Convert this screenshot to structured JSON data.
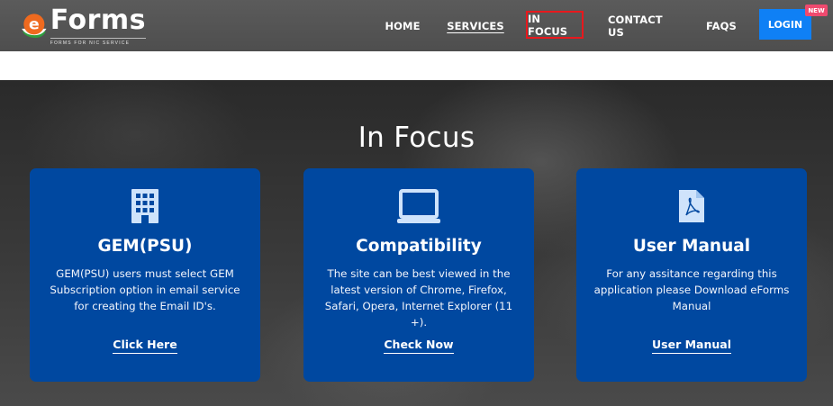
{
  "header": {
    "logo_letter": "e",
    "logo_word": "Forms",
    "logo_tagline": "FORMS FOR NIC SERVICE",
    "nav": [
      {
        "label": "HOME"
      },
      {
        "label": "SERVICES"
      },
      {
        "label": "IN FOCUS"
      },
      {
        "label": "CONTACT US"
      },
      {
        "label": "FAQS"
      }
    ],
    "login_label": "LOGIN",
    "new_badge": "NEW"
  },
  "colors": {
    "header_bg": "#555555",
    "login_bg": "#0f80f5",
    "new_badge_bg": "#ef4a6f",
    "card_bg": "#0048a0",
    "highlight_border": "#e8181d",
    "icon_light": "#cfe3fb"
  },
  "main": {
    "title": "In Focus",
    "cards": [
      {
        "icon": "building-icon",
        "title": "GEM(PSU)",
        "description": "GEM(PSU) users must select GEM Subscription option in email service for creating the Email ID's.",
        "link": "Click Here"
      },
      {
        "icon": "laptop-icon",
        "title": "Compatibility",
        "description": "The site can be best viewed in the latest version of Chrome, Firefox, Safari, Opera, Internet Explorer (11 +).",
        "link": "Check Now"
      },
      {
        "icon": "pdf-file-icon",
        "title": "User Manual",
        "description": "For any assitance regarding this application please Download eForms Manual",
        "link": "User Manual"
      }
    ]
  }
}
